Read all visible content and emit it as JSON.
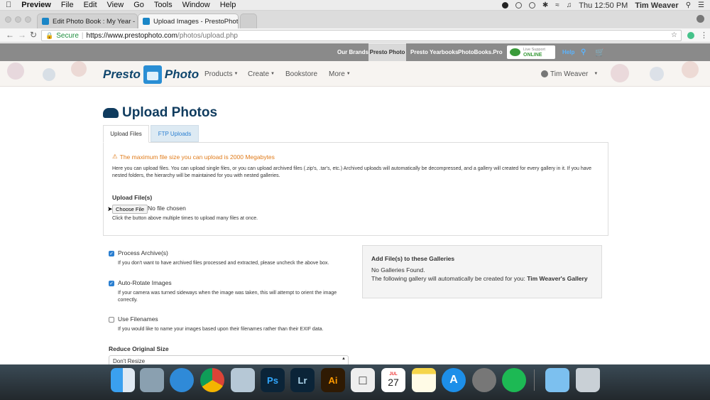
{
  "menubar": {
    "app": "Preview",
    "items": [
      "File",
      "Edit",
      "View",
      "Go",
      "Tools",
      "Window",
      "Help"
    ],
    "clock": "Thu 12:50 PM",
    "user": "Tim Weaver"
  },
  "browser": {
    "tabs": [
      {
        "title": "Edit Photo Book : My Year - Pr"
      },
      {
        "title": "Upload Images - PrestoPhoto"
      }
    ],
    "secure_label": "Secure",
    "url_host": "https://www.prestophoto.com",
    "url_path": "/photos/upload.php"
  },
  "topbar": {
    "our_brands": "Our Brands:",
    "brands": [
      "Presto Photo",
      "Presto Yearbooks",
      "PhotoBooks.Pro"
    ],
    "live_support_top": "Live Support",
    "live_support_status": "ONLINE",
    "help": "Help"
  },
  "header": {
    "logo_left": "Presto",
    "logo_right": "Photo",
    "nav": [
      "Products",
      "Create",
      "Bookstore",
      "More"
    ],
    "user": "Tim Weaver"
  },
  "page": {
    "title": "Upload Photos",
    "tabs": [
      "Upload Files",
      "FTP Uploads"
    ],
    "warning": "The maximum file size you can upload is 2000 Megabytes",
    "intro": "Here you can upload files. You can upload single files, or you can upload archived files (.zip's, .tar's, etc.) Archived uploads will automatically be decompressed, and a gallery will created for every gallery in it. If you have nested folders, the hierarchy will be maintained for you with nested galleries.",
    "upload_label": "Upload File(s)",
    "choose_file": "Choose File",
    "no_file": "No file chosen",
    "upload_hint": "Click the button above multiple times to upload many files at once.",
    "options": [
      {
        "label": "Process Archive(s)",
        "checked": true,
        "hint": "If you don't want to have archived files processed and extracted, please uncheck the above box."
      },
      {
        "label": "Auto-Rotate Images",
        "checked": true,
        "hint": "If your camera was turned sideways when the image was taken, this will attempt to orient the image correctly."
      },
      {
        "label": "Use Filenames",
        "checked": false,
        "hint": "If you would like to name your images based upon their filenames rather than their EXIF data."
      }
    ],
    "reduce_label": "Reduce Original Size",
    "reduce_value": "Don't Resize",
    "gallery_title": "Add File(s) to these Galleries",
    "gallery_none": "No Galleries Found.",
    "gallery_auto_prefix": "The following gallery will automatically be created for you:",
    "gallery_auto_name": "Tim Weaver's Gallery"
  },
  "dock": {
    "calendar_month": "JUL",
    "calendar_day": "27",
    "apps": [
      "Ps",
      "Lr",
      "Ai"
    ]
  }
}
